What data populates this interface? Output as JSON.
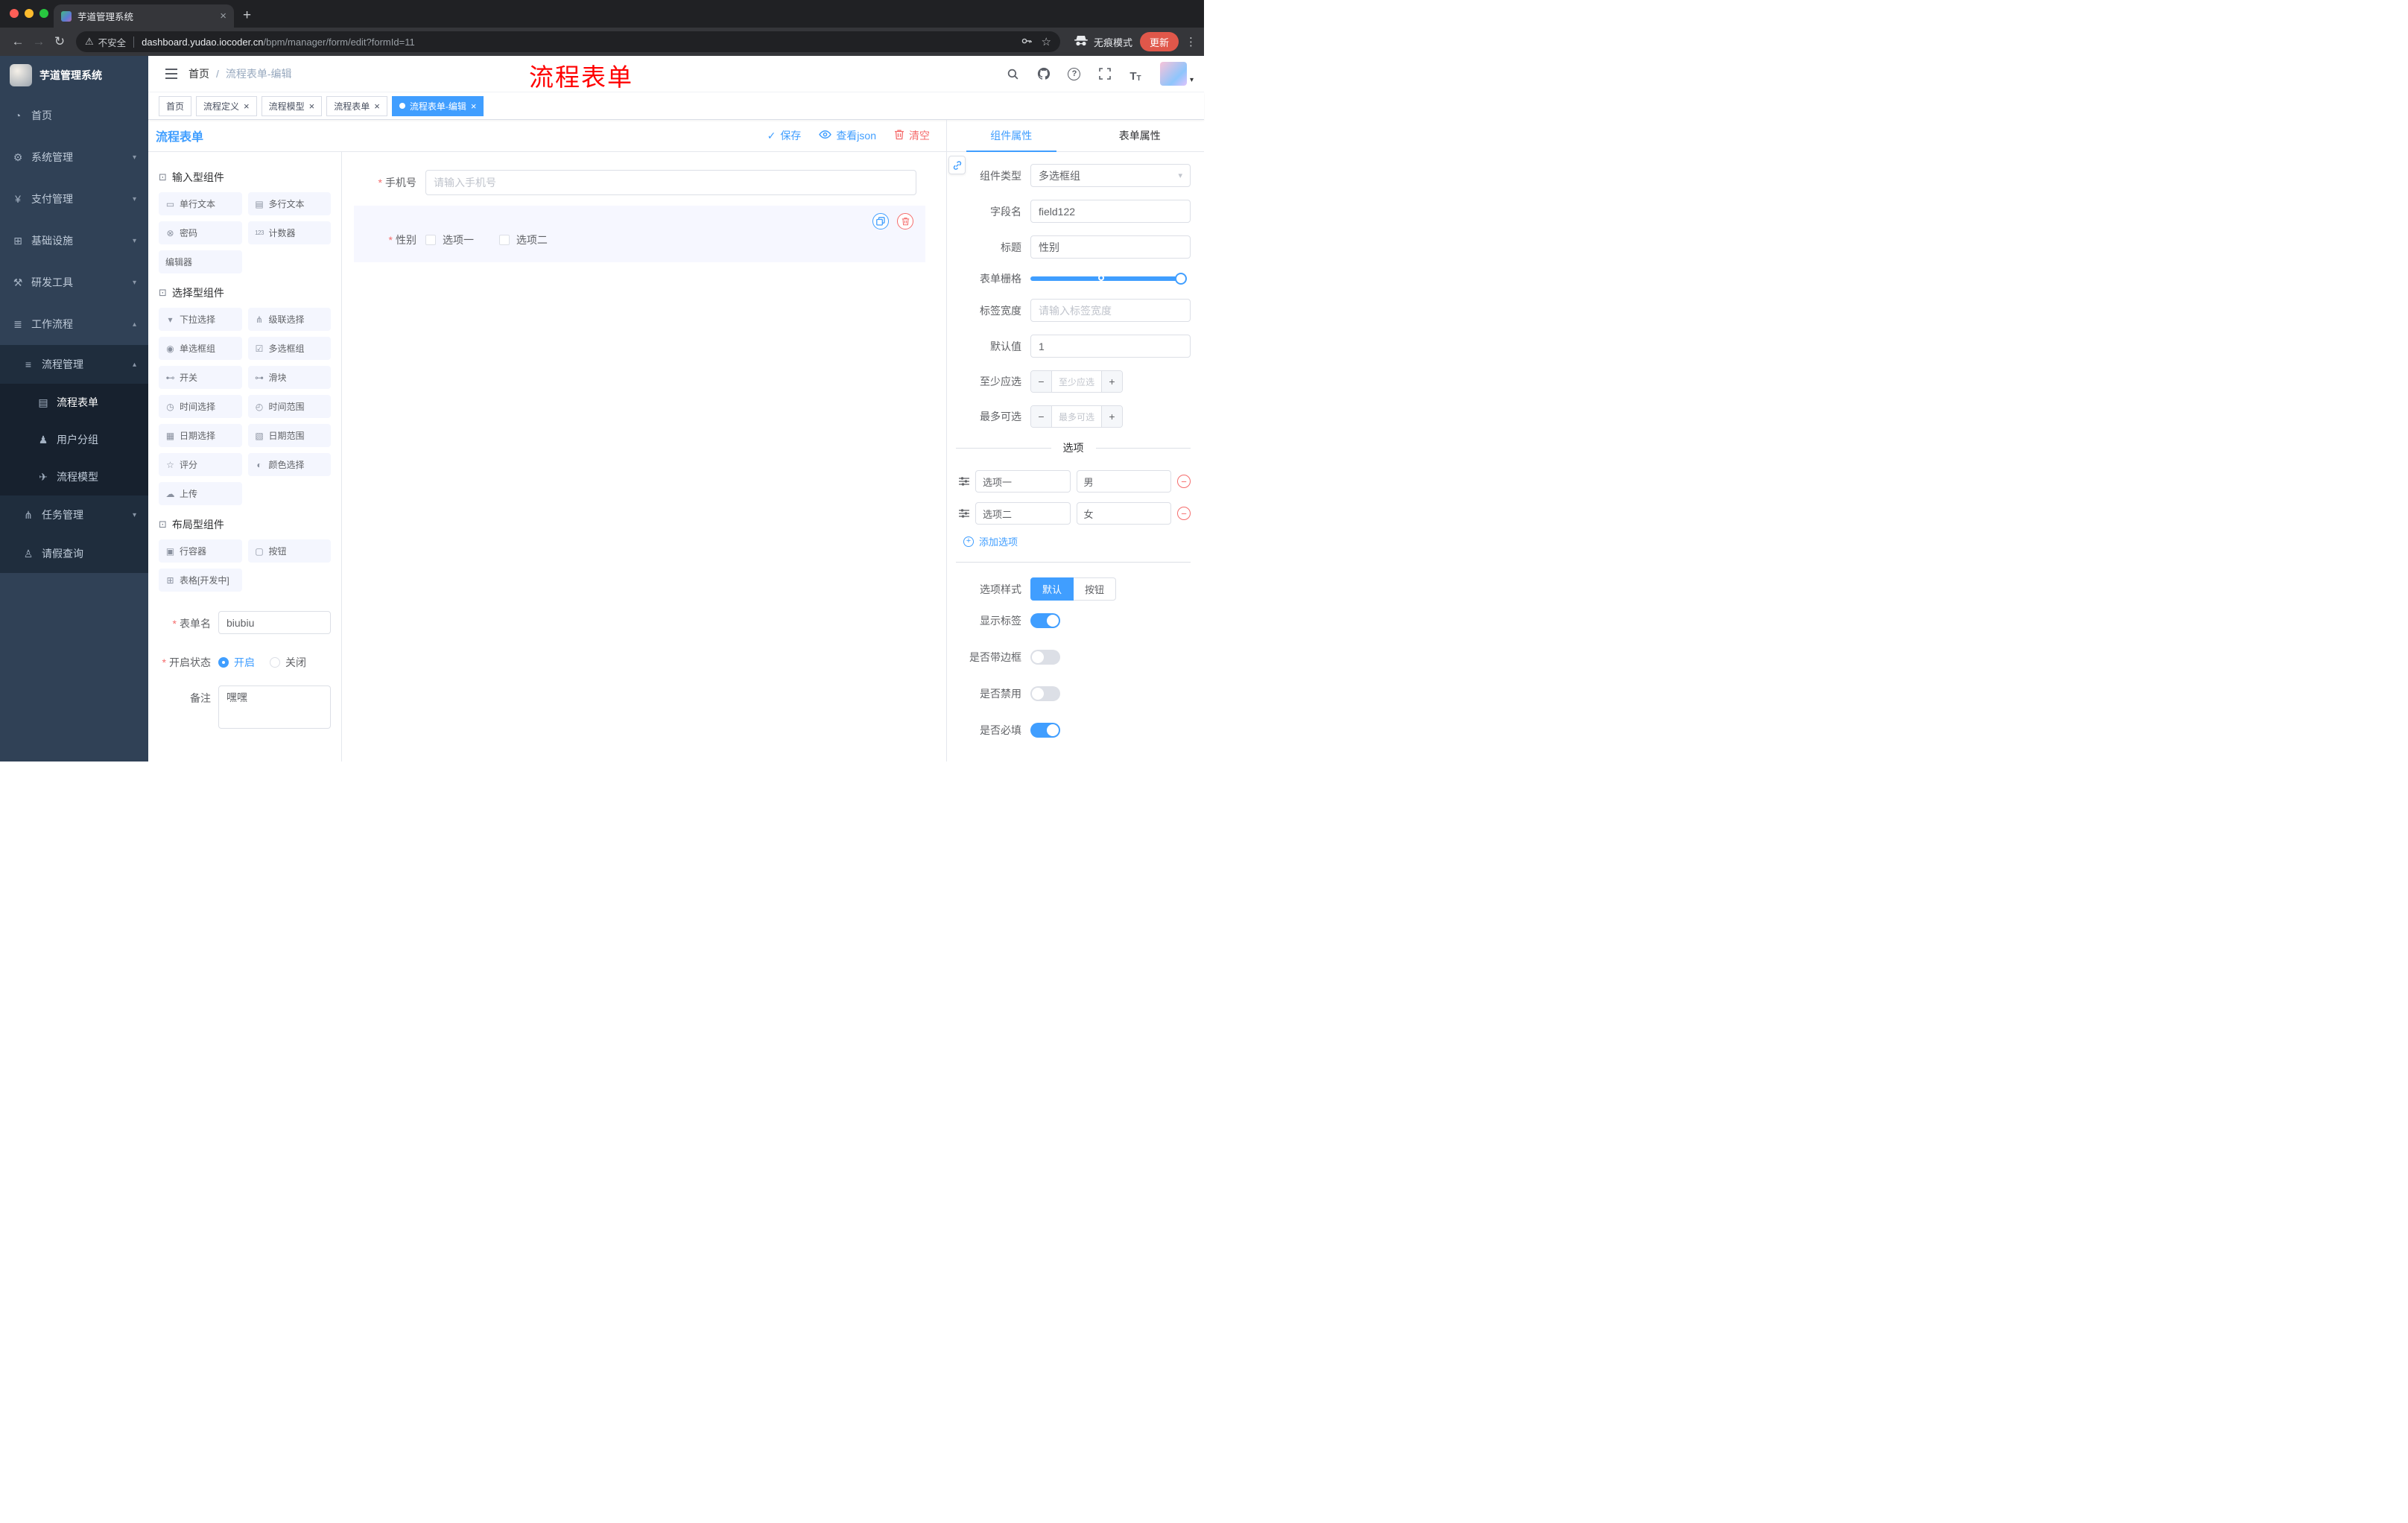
{
  "theme": {
    "accent": "#409eff",
    "danger": "#f56c6c",
    "sidebar_bg": "#304156",
    "annotation_color": "#ff0000"
  },
  "browser": {
    "tab": {
      "title": "芋道管理系统"
    },
    "address": {
      "security_label": "不安全",
      "url_host": "dashboard.yudao.iocoder.cn",
      "url_path": "/bpm/manager/form/edit?formId=11",
      "incognito_label": "无痕模式",
      "update_label": "更新"
    }
  },
  "annotation": {
    "text": "流程表单"
  },
  "sidebar": {
    "logo_title": "芋道管理系统",
    "items": [
      {
        "name": "home",
        "label": "首页",
        "icon": "dashboard-icon",
        "level": 1
      },
      {
        "name": "system-mgmt",
        "label": "系统管理",
        "icon": "gear-icon",
        "level": 1,
        "chevron": "down"
      },
      {
        "name": "payment-mgmt",
        "label": "支付管理",
        "icon": "yen-icon",
        "level": 1,
        "chevron": "down"
      },
      {
        "name": "infrastructure",
        "label": "基础设施",
        "icon": "infra-icon",
        "level": 1,
        "chevron": "down"
      },
      {
        "name": "dev-tools",
        "label": "研发工具",
        "icon": "tools-icon",
        "level": 1,
        "chevron": "down"
      },
      {
        "name": "workflow",
        "label": "工作流程",
        "icon": "workflow-icon",
        "level": 1,
        "chevron": "up",
        "expanded": true
      },
      {
        "name": "process-mgmt",
        "label": "流程管理",
        "icon": "list-icon",
        "level": 2,
        "chevron": "up",
        "expanded": true
      },
      {
        "name": "process-form",
        "label": "流程表单",
        "icon": "form-icon",
        "level": 3,
        "active": true
      },
      {
        "name": "user-group",
        "label": "用户分组",
        "icon": "users-icon",
        "level": 3
      },
      {
        "name": "process-model",
        "label": "流程模型",
        "icon": "send-icon",
        "level": 3
      },
      {
        "name": "task-mgmt",
        "label": "任务管理",
        "icon": "tree-icon",
        "level": 2,
        "chevron": "down"
      },
      {
        "name": "leave-query",
        "label": "请假查询",
        "icon": "user-icon",
        "level": 2
      }
    ]
  },
  "header": {
    "breadcrumb": [
      "首页",
      "流程表单-编辑"
    ],
    "breadcrumb_separator": "/"
  },
  "tags_view": {
    "tabs": [
      {
        "name": "home",
        "label": "首页",
        "closable": false,
        "active": false
      },
      {
        "name": "process-definition",
        "label": "流程定义",
        "closable": true,
        "active": false
      },
      {
        "name": "process-model",
        "label": "流程模型",
        "closable": true,
        "active": false
      },
      {
        "name": "process-form",
        "label": "流程表单",
        "closable": true,
        "active": false
      },
      {
        "name": "process-form-edit",
        "label": "流程表单-编辑",
        "closable": true,
        "active": true
      }
    ]
  },
  "editor": {
    "title": "流程表单",
    "actions": {
      "save": "保存",
      "view_json": "查看json",
      "clear": "清空"
    }
  },
  "components": {
    "sections": [
      {
        "title": "输入型组件",
        "items": [
          {
            "name": "single-line-text",
            "label": "单行文本",
            "icon": "input-icon"
          },
          {
            "name": "multi-line-text",
            "label": "多行文本",
            "icon": "textarea-icon"
          },
          {
            "name": "password",
            "label": "密码",
            "icon": "password-icon"
          },
          {
            "name": "counter",
            "label": "计数器",
            "icon": "counter-icon"
          },
          {
            "name": "editor",
            "label": "编辑器",
            "icon": ""
          }
        ]
      },
      {
        "title": "选择型组件",
        "items": [
          {
            "name": "select",
            "label": "下拉选择",
            "icon": "select-icon"
          },
          {
            "name": "cascader",
            "label": "级联选择",
            "icon": "cascader-icon"
          },
          {
            "name": "radio-group",
            "label": "单选框组",
            "icon": "radio-icon"
          },
          {
            "name": "checkbox-group",
            "label": "多选框组",
            "icon": "checkbox-icon"
          },
          {
            "name": "switch",
            "label": "开关",
            "icon": "switch-icon"
          },
          {
            "name": "slider",
            "label": "滑块",
            "icon": "slider-icon"
          },
          {
            "name": "time-picker",
            "label": "时间选择",
            "icon": "time-icon"
          },
          {
            "name": "time-range",
            "label": "时间范围",
            "icon": "time-range-icon"
          },
          {
            "name": "date-picker",
            "label": "日期选择",
            "icon": "date-icon"
          },
          {
            "name": "date-range",
            "label": "日期范围",
            "icon": "date-range-icon"
          },
          {
            "name": "rate",
            "label": "评分",
            "icon": "rate-icon"
          },
          {
            "name": "color-picker",
            "label": "颜色选择",
            "icon": "color-icon"
          },
          {
            "name": "upload",
            "label": "上传",
            "icon": "upload-icon"
          }
        ]
      },
      {
        "title": "布局型组件",
        "items": [
          {
            "name": "row-container",
            "label": "行容器",
            "icon": "row-icon"
          },
          {
            "name": "button",
            "label": "按钮",
            "icon": "button-icon"
          },
          {
            "name": "table-dev",
            "label": "表格[开发中]",
            "icon": "table-icon"
          }
        ]
      }
    ]
  },
  "left_form": {
    "form_name": {
      "label": "表单名",
      "value": "biubiu",
      "required": true
    },
    "status": {
      "label": "开启状态",
      "required": true,
      "options": [
        {
          "label": "开启",
          "selected": true
        },
        {
          "label": "关闭",
          "selected": false
        }
      ]
    },
    "remark": {
      "label": "备注",
      "value": "嘿嘿"
    }
  },
  "canvas": {
    "fields": [
      {
        "label": "手机号",
        "required": true,
        "type": "input",
        "placeholder": "请输入手机号"
      },
      {
        "label": "性别",
        "required": true,
        "type": "checkbox-group",
        "selected": true,
        "options": [
          "选项一",
          "选项二"
        ]
      }
    ]
  },
  "properties": {
    "tabs": [
      {
        "label": "组件属性",
        "active": true
      },
      {
        "label": "表单属性",
        "active": false
      }
    ],
    "fields": {
      "component_type": {
        "label": "组件类型",
        "value": "多选框组"
      },
      "field_name": {
        "label": "字段名",
        "value": "field122"
      },
      "title": {
        "label": "标题",
        "value": "性别"
      },
      "grid": {
        "label": "表单栅格"
      },
      "label_width": {
        "label": "标签宽度",
        "placeholder": "请输入标签宽度"
      },
      "default_value": {
        "label": "默认值",
        "value": "1"
      },
      "min_select": {
        "label": "至少应选",
        "placeholder": "至少应选"
      },
      "max_select": {
        "label": "最多可选",
        "placeholder": "最多可选"
      }
    },
    "options": {
      "title": "选项",
      "rows": [
        {
          "label": "选项一",
          "value": "男"
        },
        {
          "label": "选项二",
          "value": "女"
        }
      ],
      "add_label": "添加选项"
    },
    "style": {
      "label": "选项样式",
      "buttons": [
        {
          "label": "默认",
          "active": true
        },
        {
          "label": "按钮",
          "active": false
        }
      ]
    },
    "switches": [
      {
        "name": "show-label",
        "label": "显示标签",
        "on": true
      },
      {
        "name": "bordered",
        "label": "是否带边框",
        "on": false
      },
      {
        "name": "disabled",
        "label": "是否禁用",
        "on": false
      },
      {
        "name": "required",
        "label": "是否必填",
        "on": true
      }
    ]
  }
}
